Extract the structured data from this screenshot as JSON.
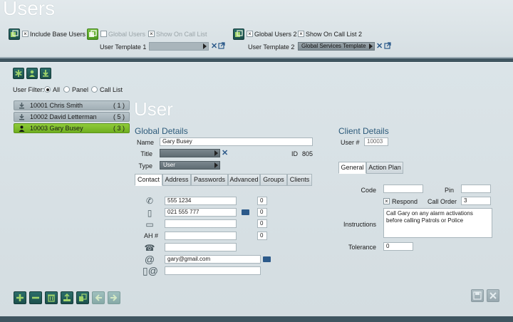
{
  "header": {
    "title": "Users",
    "include_base_users": {
      "label": "Include Base Users",
      "checked": true
    },
    "global_users": {
      "label": "Global Users",
      "checked": false
    },
    "show_on_call_list": {
      "label": "Show On Call List",
      "checked": true
    },
    "global_users_2": {
      "label": "Global Users 2",
      "checked": true
    },
    "show_on_call_list_2": {
      "label": "Show On Call List 2",
      "checked": true
    },
    "user_template_1": {
      "label": "User Template 1",
      "value": ""
    },
    "user_template_2": {
      "label": "User Template 2",
      "value": "Global Services Template"
    }
  },
  "toolbar": {
    "icons": [
      "asterisk-icon",
      "person-add-icon",
      "download-icon"
    ]
  },
  "filter": {
    "label": "User Filter:",
    "options": [
      "All",
      "Panel",
      "Call List"
    ],
    "selected": "All"
  },
  "user_list": [
    {
      "id": "10001",
      "name": "Chris Smith",
      "count": "( 1 )",
      "selected": false
    },
    {
      "id": "10002",
      "name": "David Letterman",
      "count": "( 5 )",
      "selected": false
    },
    {
      "id": "10003",
      "name": "Gary Busey",
      "count": "( 3 )",
      "selected": true
    }
  ],
  "user": {
    "heading": "User",
    "global_details_title": "Global Details",
    "name_label": "Name",
    "name_value": "Gary Busey",
    "title_label": "Title",
    "title_value": "",
    "id_label": "ID",
    "id_value": "805",
    "type_label": "Type",
    "type_value": "User"
  },
  "tabs": [
    "Contact",
    "Address",
    "Passwords",
    "Advanced",
    "Groups",
    "Clients"
  ],
  "active_tab": "Contact",
  "contact": {
    "phone": "555 1234",
    "phone_ext": "0",
    "mobile": "021 555 777",
    "mobile_ext": "0",
    "pager": "",
    "pager_ext": "0",
    "ah_label": "AH #",
    "ah": "",
    "ah_ext": "0",
    "fax": "",
    "email": "gary@gmail.com",
    "sms_email": ""
  },
  "client": {
    "title": "Client Details",
    "user_num_label": "User #",
    "user_num_value": "10003",
    "tabs": [
      "General",
      "Action Plan"
    ],
    "active_tab": "General",
    "code_label": "Code",
    "code_value": "",
    "pin_label": "Pin",
    "pin_value": "",
    "respond_label": "Respond",
    "respond_checked": true,
    "call_order_label": "Call Order",
    "call_order_value": "3",
    "instructions_label": "Instructions",
    "instructions_value": "Call Gary on any alarm activations before calling Patrols or Police",
    "tolerance_label": "Tolerance",
    "tolerance_value": "0"
  },
  "colors": {
    "accent_green": "#7ac143",
    "accent_teal": "#1c4f4c",
    "title_blue": "#2c5a7a"
  }
}
